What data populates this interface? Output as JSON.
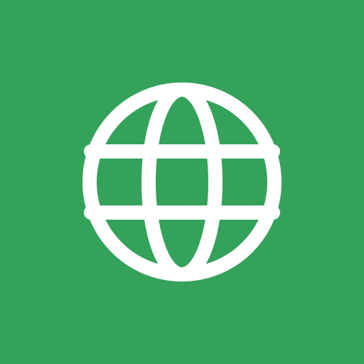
{
  "app": {
    "icon_name": "globe-icon",
    "background_color": "#34a25b",
    "icon_color": "#ffffff"
  }
}
